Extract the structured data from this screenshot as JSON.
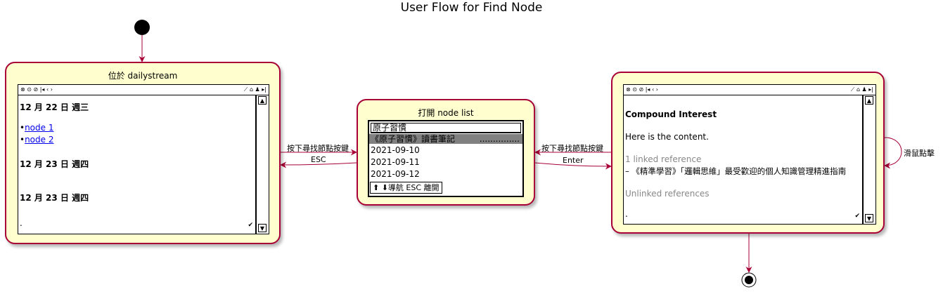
{
  "title": "User Flow for Find Node",
  "colors": {
    "state_fill": "#fefece",
    "state_border": "#a80036",
    "link": "#0000ee",
    "highlight": "#808080",
    "muted": "#888888"
  },
  "icons": [
    "start-node-icon",
    "end-node-icon",
    "arrow-icon",
    "close-circle-icon",
    "sync-circle-icon",
    "check-circle-icon",
    "first-page-icon",
    "back-chevron-icon",
    "forward-chevron-icon",
    "edit-icon",
    "home-icon",
    "user-icon",
    "last-page-icon",
    "scroll-up-icon",
    "scroll-down-icon"
  ],
  "toolbar": {
    "left": "⊗ ⊙ ⊘  |◂ ‹ ›",
    "right": "⟋ ⌂ ♟ ▸|"
  },
  "state_daily": {
    "title": "位於 dailystream",
    "heading1": "12 月 22 日 週三",
    "bullet": "•",
    "link1": "node 1",
    "link2": "node 2",
    "heading2": "12 月 23 日 週四",
    "heading3": "12 月 23 日 週四",
    "footer_dot": "."
  },
  "state_nodelist": {
    "title": "打開 node list",
    "search_value": "原子習慣",
    "items": [
      "《原子習慣》讀書筆記",
      "2021-09-10",
      "2021-09-11",
      "2021-09-12"
    ],
    "selected_suffix": "...............",
    "help": "⬆ ⬇導航 ESC 離開"
  },
  "state_compound": {
    "title": "Compound Interest",
    "body": "Here is the content.",
    "linked": "1 linked reference",
    "ref": "– 《精準學習》「邏輯思維」最受歡迎的個人知識管理精進指南",
    "unlinked": "Unlinked references",
    "footer_dot": "."
  },
  "transitions": {
    "find_left": "按下尋找節點按鍵",
    "esc": "ESC",
    "find_right": "按下尋找節點按鍵",
    "enter": "Enter",
    "mouse": "滑鼠點擊"
  }
}
